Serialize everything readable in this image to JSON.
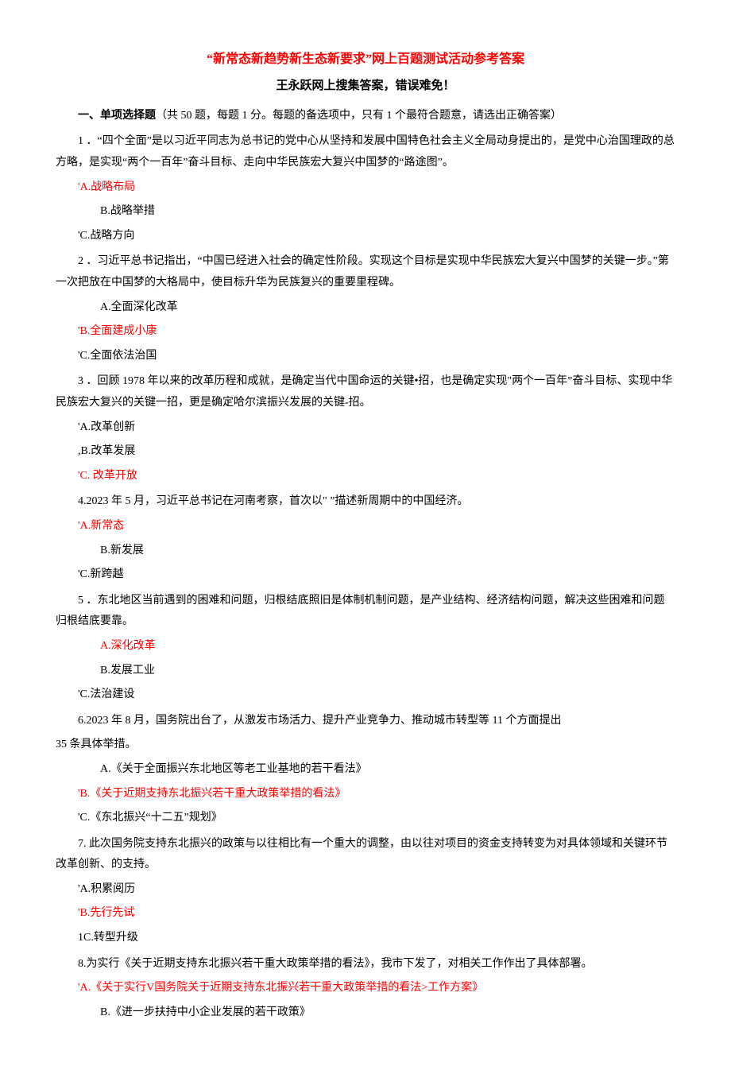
{
  "title_main": "“新常态新趋势新生态新要求”网上百题测试活动参考答案",
  "title_sub": "王永跃网上搜集答案，错误难免！",
  "section_header_bold": "一、单项选择题",
  "section_header_rest": "（共 50 题，每题 1 分。每题的备选项中，只有 1 个最符合题意，请选出正确答案）",
  "q1": {
    "text": "1 ．“四个全面”是以习近平同志为总书记的党中心从坚持和发展中国特色社会主义全局动身提出的，是党中心治国理政的总方略，是实现“两个一百年”奋斗目标、走向中华民族宏大复兴中国梦的“路途图”。",
    "a": "'A.战略布局",
    "b": "B.战略举措",
    "c": "'C.战略方向"
  },
  "q2": {
    "text": "2 ．习近平总书记指出，“中国已经进入社会的确定性阶段。实现这个目标是实现中华民族宏大复兴中国梦的关键一步。”第一次把放在中国梦的大格局中，使目标升华为民族复兴的重要里程碑。",
    "a": "A.全面深化改革",
    "b": "'B.全面建成小康",
    "c": "'C.全面依法治国"
  },
  "q3": {
    "text": "3 ．回顾 1978 年以来的改革历程和成就，是确定当代中国命运的关键•招，也是确定实现\"两个一百年”奋斗目标、实现中华民族宏大复兴的关键一招，更是确定哈尔滨振兴发展的关键-招。",
    "a": "'A.改革创新",
    "b": ",B.改革发展",
    "c": "'C. 改革开放"
  },
  "q4": {
    "text": "4.2023 年 5 月，习近平总书记在河南考察，首次以\" ”描述新周期中的中国经济。",
    "a": "'A.新常态",
    "b": "B.新发展",
    "c": "'C.新跨越"
  },
  "q5": {
    "text": "5 ．东北地区当前遇到的困难和问题，归根结底照旧是体制机制问题，是产业结构、经济结构问题，解决这些困难和问题归根结底要靠。",
    "a": "A.深化改革",
    "b": "B.发展工业",
    "c": "'C.法治建设"
  },
  "q6": {
    "text1": "6.2023 年 8 月，国务院出台了，从激发市场活力、提升产业竞争力、推动城市转型等 11 个方面提出",
    "text2": "35 条具体举措。",
    "a": "A.《关于全面振兴东北地区等老工业基地的若干看法》",
    "b": "'B.《关于近期支持东北振兴若干重大政策举措的看法》",
    "c": "'C.《东北振兴“十二五”规划》"
  },
  "q7": {
    "text": "7. 此次国务院支持东北振兴的政策与以往相比有一个重大的调整，由以往对项目的资金支持转变为对具体领域和关键环节改革创新、的支持。",
    "a": "'A.积累阅历",
    "b": "'B.先行先试",
    "c": "1C.转型升级"
  },
  "q8": {
    "text": "8.为实行《关于近期支持东北振兴若干重大政策举措的看法》，我市下发了，对相关工作作出了具体部署。",
    "a": "'A.《关于实行V国务院关于近期支持东北振兴若干重大政策举措的看法>工作方案》",
    "b": "B.《进一步扶持中小企业发展的若干政策》"
  }
}
